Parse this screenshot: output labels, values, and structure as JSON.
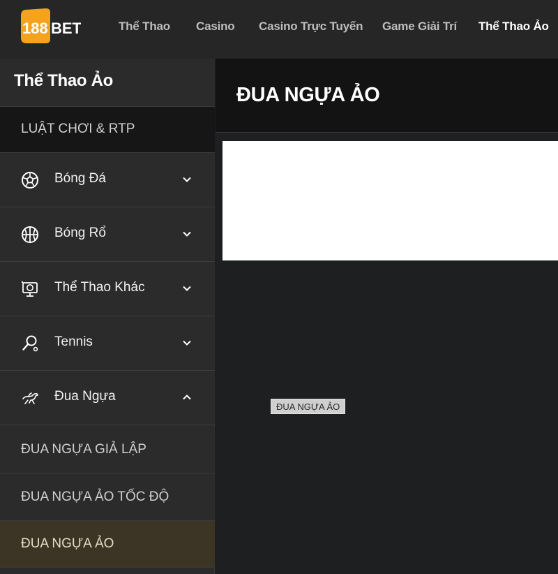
{
  "brand": {
    "logo_text": "188BET",
    "accent": "#f5a21c"
  },
  "nav": {
    "items": [
      {
        "label": "Thể Thao",
        "active": false
      },
      {
        "label": "Casino",
        "active": false
      },
      {
        "label": "Casino Trực Tuyến",
        "active": false
      },
      {
        "label": "Game Giải Trí",
        "active": false
      },
      {
        "label": "Thể Thao Ảo",
        "active": true
      }
    ]
  },
  "sidebar": {
    "title": "Thể Thao Ảo",
    "rules_link": "LUẬT CHƠI & RTP",
    "categories": [
      {
        "label": "Bóng Đá",
        "icon": "soccer-ball-icon",
        "expanded": false
      },
      {
        "label": "Bóng Rổ",
        "icon": "basketball-icon",
        "expanded": false
      },
      {
        "label": "Thể Thao Khác",
        "icon": "monitor-sports-icon",
        "expanded": false
      },
      {
        "label": "Tennis",
        "icon": "tennis-racket-icon",
        "expanded": false
      },
      {
        "label": "Đua Ngựa",
        "icon": "horse-racing-icon",
        "expanded": true
      }
    ],
    "subitems": [
      {
        "label": "ĐUA NGỰA GIẢ LẬP",
        "active": false
      },
      {
        "label": "ĐUA NGỰA ẢO TỐC ĐỘ",
        "active": false
      },
      {
        "label": "ĐUA NGỰA ẢO",
        "active": true
      }
    ],
    "active_color": "#3c3526"
  },
  "main": {
    "title": "ĐUA NGỰA ẢO",
    "image_alt": "ĐUA NGỰA ẢO"
  }
}
